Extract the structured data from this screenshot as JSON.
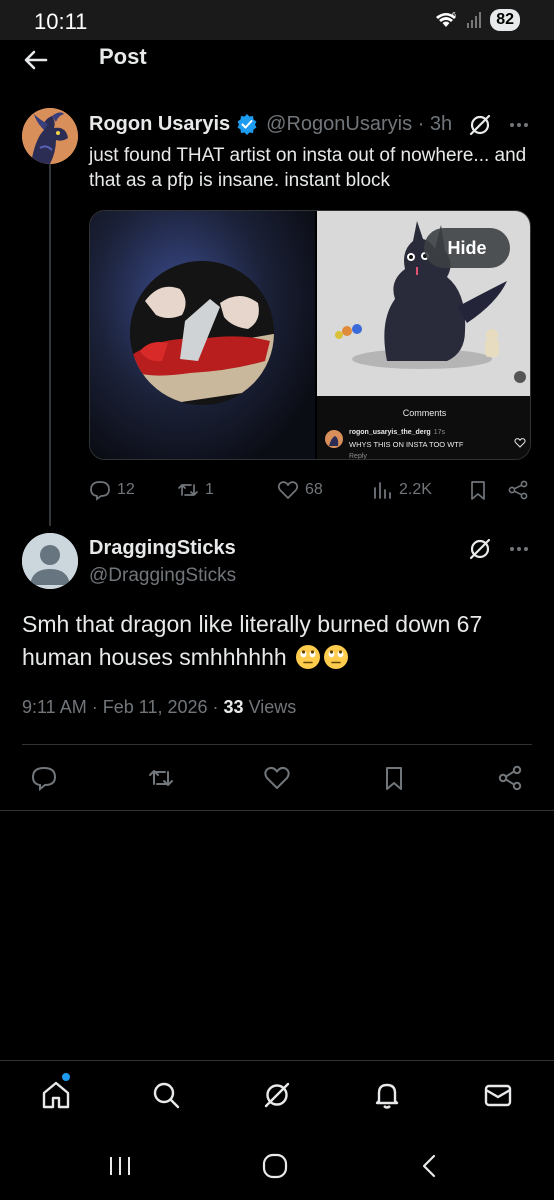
{
  "status_bar": {
    "time": "10:11",
    "network": "6",
    "battery": "82"
  },
  "header": {
    "title": "Post"
  },
  "post1": {
    "author_name": "Rogon Usaryis",
    "handle": "@RogonUsaryis",
    "separator": "·",
    "time": "3h",
    "text": "just found THAT artist on insta out of nowhere... and that as a pfp is insane. instant block",
    "media": {
      "hide_label": "Hide",
      "ig_comments_title": "Comments",
      "ig_user": "rogon_usaryis_the_derg",
      "ig_time": "17s",
      "ig_comment": "WHYS THIS ON INSTA TOO WTF",
      "ig_reply": "Reply"
    },
    "stats": {
      "replies": "12",
      "reposts": "1",
      "likes": "68",
      "views": "2.2K"
    }
  },
  "post2": {
    "author_name": "DraggingSticks",
    "handle": "@DraggingSticks",
    "text": "Smh that dragon like literally burned down 67 human houses smhhhhhh",
    "emojis": [
      "face-with-rolling-eyes",
      "face-with-rolling-eyes"
    ],
    "time": "9:11 AM",
    "date": "Feb 11, 2026",
    "views_count": "33",
    "views_label": "Views",
    "sep": "·"
  },
  "colors": {
    "accent": "#1d9bf0",
    "muted": "#71767b",
    "text": "#e7e9ea",
    "bg": "#000000",
    "border": "#2f3336"
  },
  "bottom_nav": [
    "home-icon",
    "search-icon",
    "grok-icon",
    "notifications-icon",
    "messages-icon"
  ],
  "system_nav": [
    "recents-icon",
    "home-circle-icon",
    "back-chevron-icon"
  ]
}
